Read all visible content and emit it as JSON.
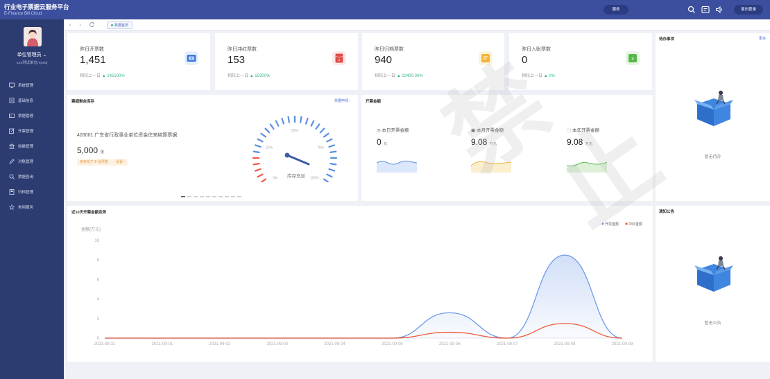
{
  "brand": {
    "title": "行业电子票据云服务平台",
    "subtitle": "E-Finance Bill Cloud"
  },
  "header": {
    "service_label": "服务",
    "logout_label": "退出登录"
  },
  "user": {
    "name": "单位管理员 ⌄",
    "org": "xxx测试单位mysql"
  },
  "sidebar": {
    "items": [
      {
        "label": "系统管理",
        "icon": "monitor-icon"
      },
      {
        "label": "基础信息",
        "icon": "document-icon"
      },
      {
        "label": "票据管理",
        "icon": "card-icon"
      },
      {
        "label": "开票管理",
        "icon": "edit-icon"
      },
      {
        "label": "收缴管理",
        "icon": "bank-icon"
      },
      {
        "label": "对账管理",
        "icon": "pen-icon"
      },
      {
        "label": "票据查询",
        "icon": "search-icon"
      },
      {
        "label": "归档管理",
        "icon": "archive-icon"
      },
      {
        "label": "常用服务",
        "icon": "star-icon"
      }
    ]
  },
  "tabs": {
    "home": "数据首页"
  },
  "stats": [
    {
      "label": "昨日开票数",
      "value": "1,451",
      "compare_prefix": "相较上一日",
      "compare": "▲ 145100%",
      "color": "#3a7be0"
    },
    {
      "label": "昨日冲红票数",
      "value": "153",
      "compare_prefix": "相较上一日",
      "compare": "▲ 15300%",
      "color": "#e04b4b"
    },
    {
      "label": "昨日归档票数",
      "value": "940",
      "compare_prefix": "相较上一日",
      "compare": "▲ 23400.00%",
      "color": "#f2b43a"
    },
    {
      "label": "昨日入账票数",
      "value": "0",
      "compare_prefix": "相较上一日",
      "compare": "▲ 0%",
      "color": "#56b84a"
    }
  ],
  "stock": {
    "title": "票据剩余库存",
    "link": "票据申领 ›",
    "bill_name": "403001 广东省行政事业单位资金往来结算票据",
    "count": "5,000",
    "count_unit": "张",
    "warn_prefix": "库存低于",
    "warn_value": "0",
    "warn_suffix": "张预警",
    "warn_setting": "设置 ›",
    "gauge_label": "库存充足",
    "gauge_ticks": [
      "0%",
      "25%",
      "50%",
      "75%",
      "100%"
    ]
  },
  "amount": {
    "title": "开票金额",
    "items": [
      {
        "label": "本日开票金额",
        "value": "0",
        "unit": "元",
        "icon": "clock-icon"
      },
      {
        "label": "本月开票金额",
        "value": "9.08",
        "unit": "万元",
        "icon": "calendar-icon"
      },
      {
        "label": "本年开票金额",
        "value": "9.08",
        "unit": "万元",
        "icon": "box-icon"
      }
    ]
  },
  "todo": {
    "title": "待办事项",
    "more": "更多",
    "empty": "暂无待办"
  },
  "notice": {
    "title": "通知公告",
    "empty": "暂无公告"
  },
  "trend": {
    "title": "近10天开票金额走势"
  },
  "chart_data": {
    "type": "line",
    "title": "",
    "ylabel": "金额(万元)",
    "xlabel": "",
    "ylim": [
      0,
      10
    ],
    "yticks": [
      0,
      2,
      4,
      6,
      8,
      10
    ],
    "legend_position": "top-right",
    "categories": [
      "2021-08-31",
      "2021-09-01",
      "2021-09-02",
      "2021-09-03",
      "2021-09-04",
      "2021-09-05",
      "2021-09-06",
      "2021-09-07",
      "2021-09-08",
      "2021-09-09"
    ],
    "series": [
      {
        "name": "开票金额",
        "color": "#6e9ae8",
        "values": [
          0,
          0,
          0,
          0,
          0,
          0,
          2.6,
          0,
          8.5,
          0
        ]
      },
      {
        "name": "冲红金额",
        "color": "#ee5a3c",
        "values": [
          0,
          0,
          0,
          0,
          0,
          0,
          0.6,
          0,
          1.5,
          0
        ]
      }
    ]
  }
}
